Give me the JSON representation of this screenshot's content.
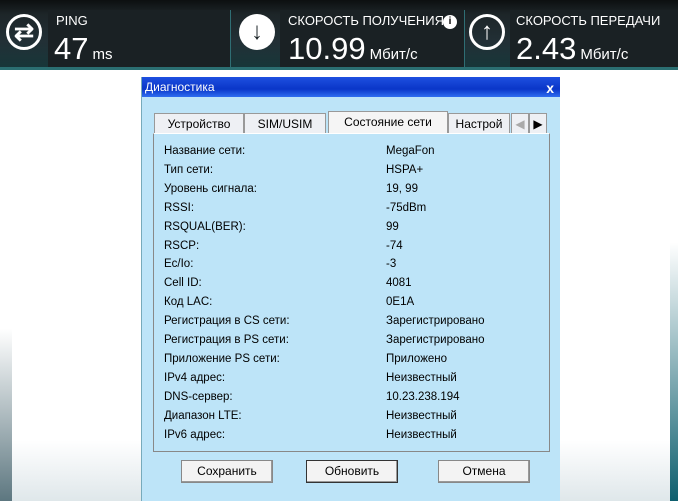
{
  "stats": {
    "ping": {
      "label": "PING",
      "value": "47",
      "unit": "ms"
    },
    "download": {
      "label": "СКОРОСТЬ ПОЛУЧЕНИЯ",
      "value": "10.99",
      "unit": "Мбит/с"
    },
    "upload": {
      "label": "СКОРОСТЬ ПЕРЕДАЧИ",
      "value": "2.43",
      "unit": "Мбит/с"
    }
  },
  "dialog": {
    "title": "Диагностика",
    "close": "x",
    "tabs": [
      "Устройство",
      "SIM/USIM",
      "Состояние сети",
      "Настрой"
    ],
    "rows": [
      {
        "label": "Название сети:",
        "value": "MegaFon"
      },
      {
        "label": "Тип сети:",
        "value": "HSPA+"
      },
      {
        "label": "Уровень сигнала:",
        "value": "19, 99"
      },
      {
        "label": "RSSI:",
        "value": "-75dBm"
      },
      {
        "label": "RSQUAL(BER):",
        "value": "99"
      },
      {
        "label": "RSCP:",
        "value": "-74"
      },
      {
        "label": "Ec/Io:",
        "value": "-3"
      },
      {
        "label": "Cell ID:",
        "value": "4081"
      },
      {
        "label": "Код LAC:",
        "value": "0E1A"
      },
      {
        "label": "Регистрация в CS сети:",
        "value": "Зарегистрировано"
      },
      {
        "label": "Регистрация в PS сети:",
        "value": "Зарегистрировано"
      },
      {
        "label": "Приложение PS сети:",
        "value": "Приложено"
      },
      {
        "label": "IPv4 адрес:",
        "value": "Неизвестный"
      },
      {
        "label": "DNS-сервер:",
        "value": "10.23.238.194"
      },
      {
        "label": "Диапазон LTE:",
        "value": "Неизвестный"
      },
      {
        "label": "IPv6 адрес:",
        "value": "Неизвестный"
      }
    ],
    "buttons": {
      "save": "Сохранить",
      "refresh": "Обновить",
      "cancel": "Отмена"
    }
  }
}
